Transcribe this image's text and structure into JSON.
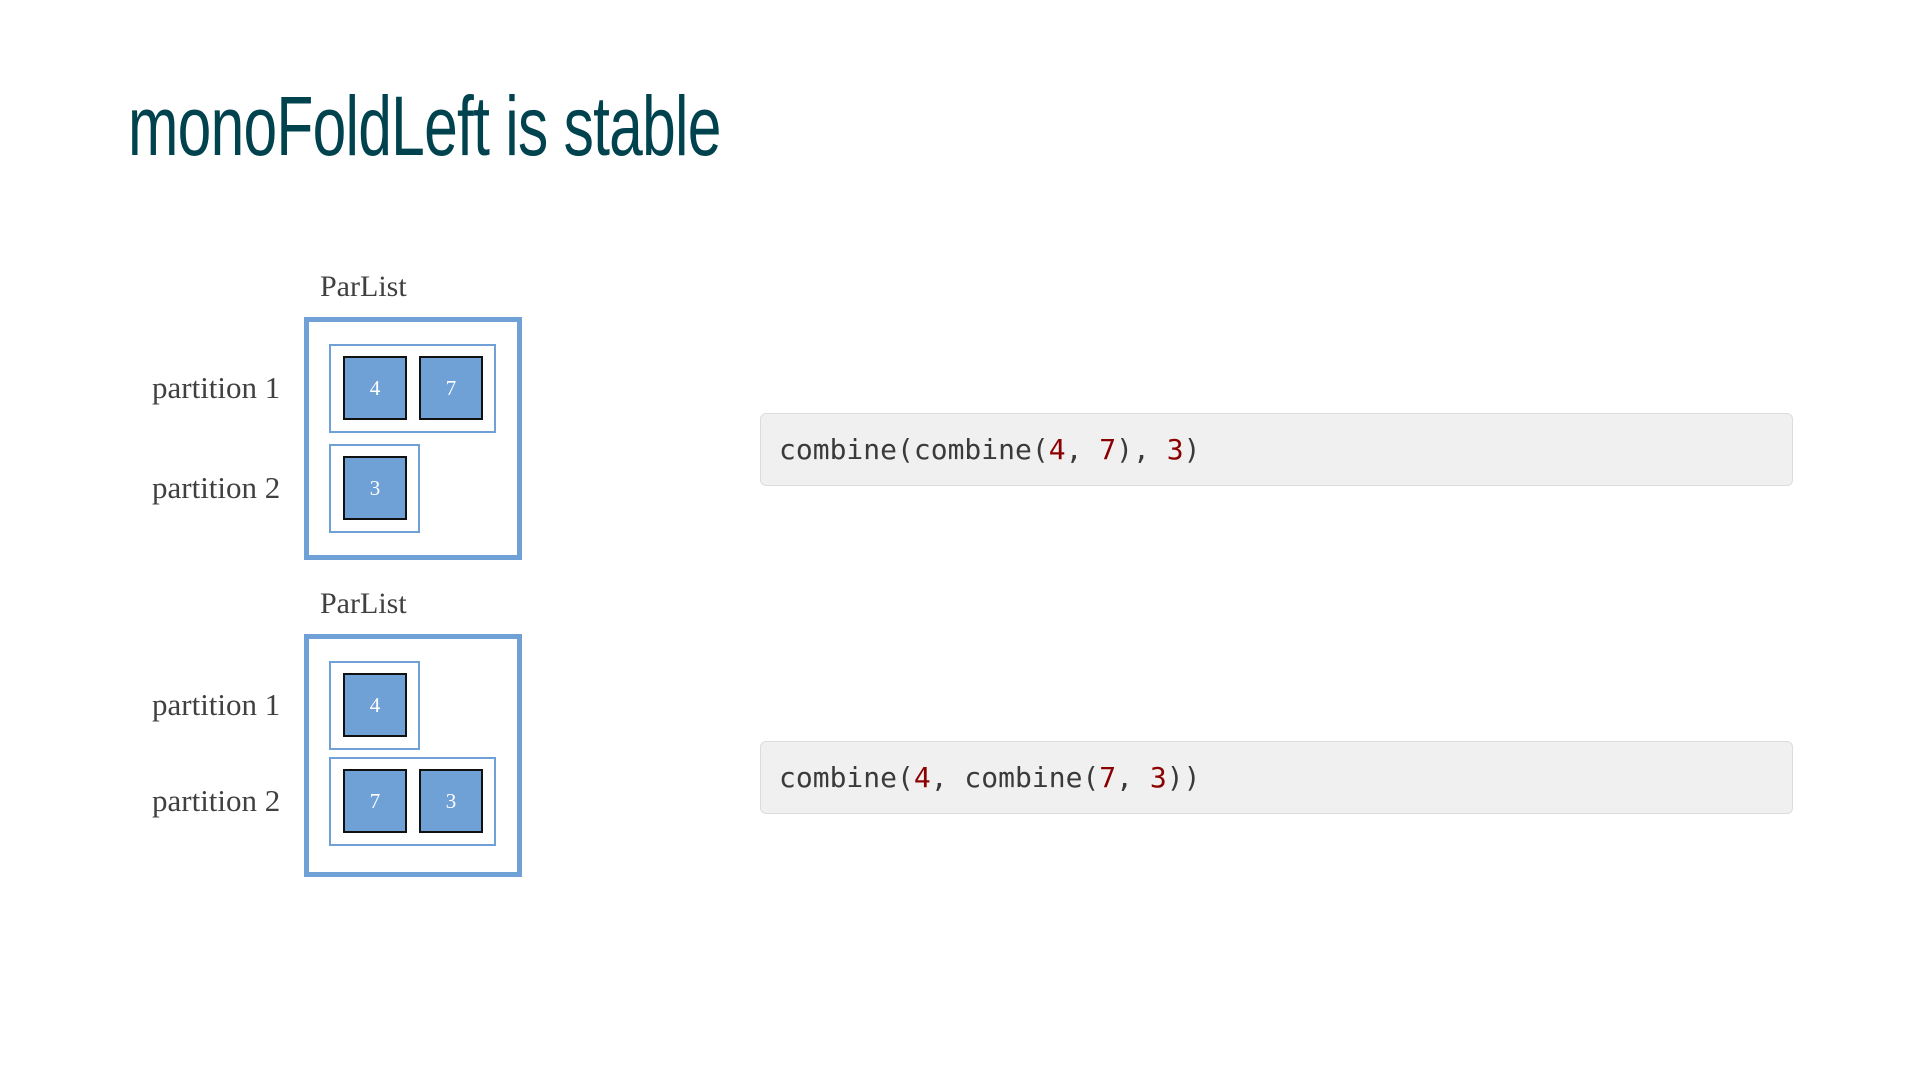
{
  "title": "monoFoldLeft is stable",
  "colors": {
    "title": "#00434e",
    "box": "#6fa1d6",
    "number": "#8b0000",
    "code_bg": "#f0f0f0"
  },
  "diagrams": [
    {
      "label": "ParList",
      "partitions": [
        {
          "label": "partition 1",
          "values": [
            "4",
            "7"
          ]
        },
        {
          "label": "partition 2",
          "values": [
            "3"
          ]
        }
      ],
      "code": [
        {
          "t": "combine(combine("
        },
        {
          "t": "4",
          "num": true
        },
        {
          "t": ", "
        },
        {
          "t": "7",
          "num": true
        },
        {
          "t": "), "
        },
        {
          "t": "3",
          "num": true
        },
        {
          "t": ")"
        }
      ]
    },
    {
      "label": "ParList",
      "partitions": [
        {
          "label": "partition 1",
          "values": [
            "4"
          ]
        },
        {
          "label": "partition 2",
          "values": [
            "7",
            "3"
          ]
        }
      ],
      "code": [
        {
          "t": "combine("
        },
        {
          "t": "4",
          "num": true
        },
        {
          "t": ", combine("
        },
        {
          "t": "7",
          "num": true
        },
        {
          "t": ", "
        },
        {
          "t": "3",
          "num": true
        },
        {
          "t": "))"
        }
      ]
    }
  ]
}
